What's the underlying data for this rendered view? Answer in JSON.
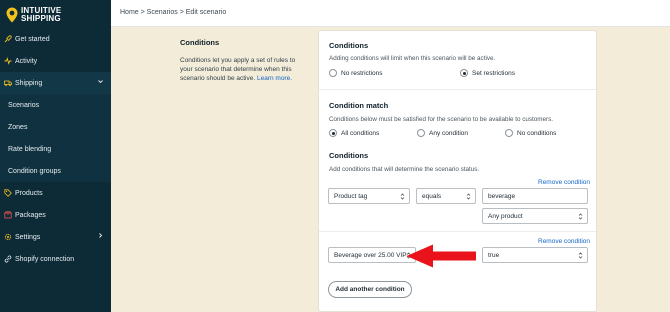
{
  "brand": {
    "name_line1": "INTUITIVE",
    "name_line2": "SHIPPING",
    "accent": "#f2c21b"
  },
  "sidebar": {
    "items": [
      {
        "label": "Get started",
        "icon": "rocket-icon"
      },
      {
        "label": "Activity",
        "icon": "activity-icon"
      },
      {
        "label": "Shipping",
        "icon": "truck-icon",
        "chevron": "chevron-down-icon"
      },
      {
        "label": "Scenarios"
      },
      {
        "label": "Zones"
      },
      {
        "label": "Rate blending"
      },
      {
        "label": "Condition groups"
      },
      {
        "label": "Products",
        "icon": "tag-icon"
      },
      {
        "label": "Packages",
        "icon": "box-icon"
      },
      {
        "label": "Settings",
        "icon": "gear-icon",
        "chevron": "chevron-right-icon"
      },
      {
        "label": "Shopify connection",
        "icon": "link-icon"
      }
    ]
  },
  "breadcrumb": "Home > Scenarios > Edit scenario",
  "section": {
    "title": "Conditions",
    "description": "Conditions let you apply a set of rules to your scenario that determine when this scenario should be active.",
    "learn_more": "Learn more."
  },
  "card": {
    "conditions_title": "Conditions",
    "conditions_help": "Adding conditions will limit when this scenario will be active.",
    "restriction_options": [
      "No restrictions",
      "Set restrictions"
    ],
    "restriction_selected": "Set restrictions",
    "match_title": "Condition match",
    "match_help": "Conditions below must be satisfied for the scenario to be available to customers.",
    "match_options": [
      "All conditions",
      "Any condition",
      "No conditions"
    ],
    "match_selected": "All conditions",
    "list_title": "Conditions",
    "list_help": "Add conditions that will determine the scenario status.",
    "condition1": {
      "remove": "Remove condition",
      "field": "Product tag",
      "operator": "equals",
      "value": "beverage",
      "scope": "Any product"
    },
    "condition2": {
      "remove": "Remove condition",
      "group": "Beverage over 25.00 VIP",
      "value": "true"
    },
    "add_button": "Add another condition"
  },
  "arrow_color": "#e8131b"
}
